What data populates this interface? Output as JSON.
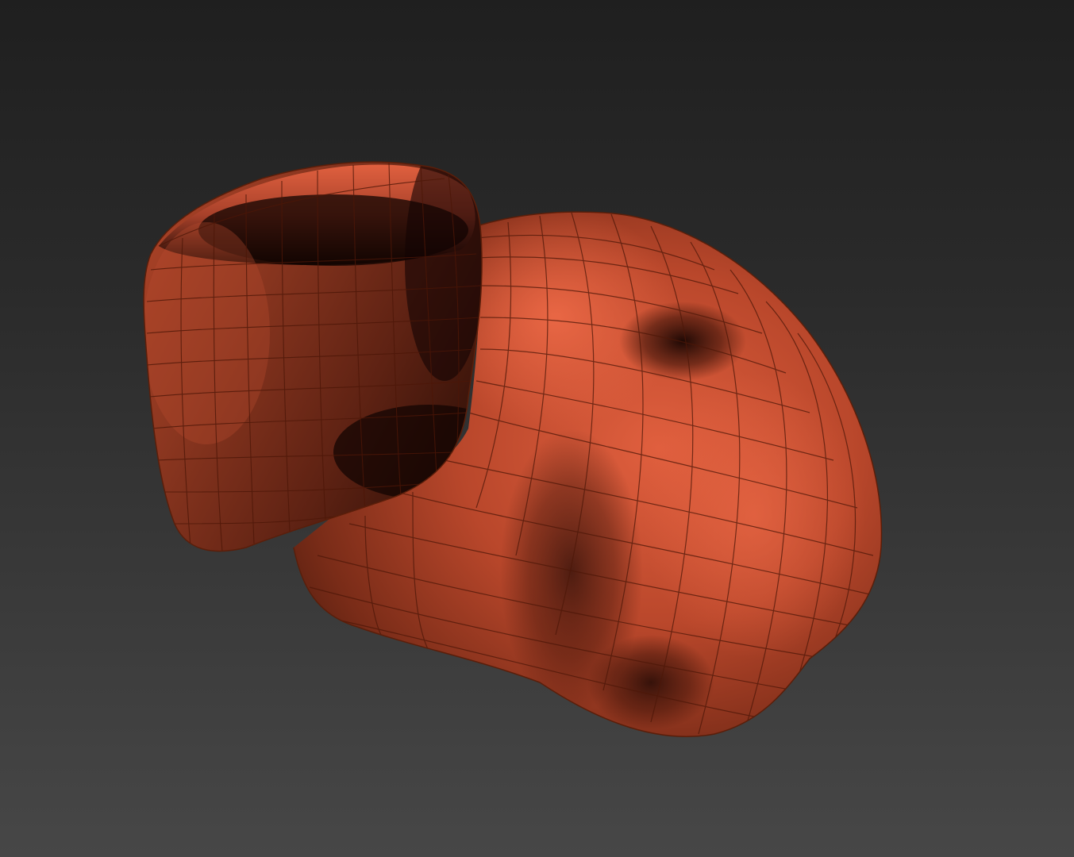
{
  "viewport": {
    "label": "",
    "background_top": "#1f1f1f",
    "background_bottom": "#474747"
  },
  "model": {
    "material_color": "#d9583a",
    "wireframe_color": "#5a1e0a",
    "shading": "smooth-with-wireframe-overlay"
  }
}
